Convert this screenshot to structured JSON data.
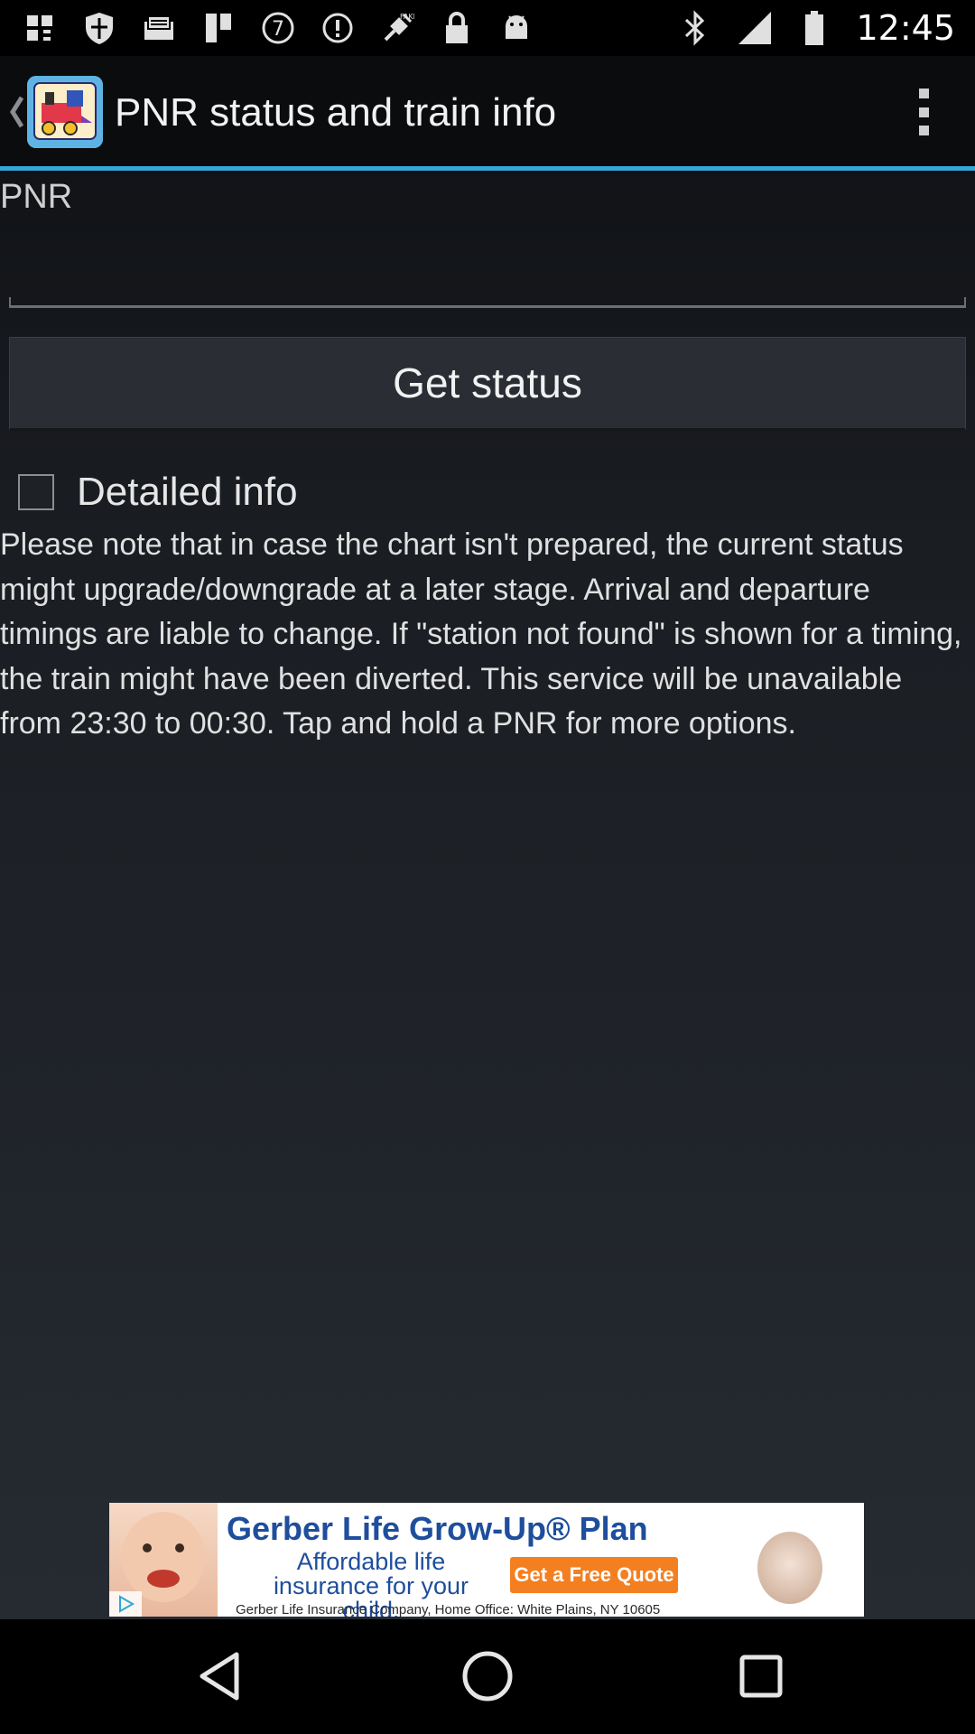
{
  "status_bar": {
    "left_icons": [
      "notification-icon",
      "shield-icon",
      "mail-icon",
      "flag-icon",
      "circled-seven-icon",
      "info-icon",
      "fake-gps-icon",
      "lock-icon",
      "android-icon"
    ],
    "right_icons": [
      "bluetooth-icon"
    ],
    "time": "12:45"
  },
  "action_bar": {
    "title": "PNR status and train info",
    "accent_color": "#33a7d8",
    "icons": [
      "back-chevron-icon",
      "app-train-icon",
      "overflow-menu-icon"
    ]
  },
  "form": {
    "pnr_label": "PNR",
    "pnr_value": "",
    "get_status_label": "Get status",
    "detailed_info_label": "Detailed info",
    "detailed_info_checked": false
  },
  "note": "Please note that in case the chart isn't prepared, the current status might upgrade/downgrade at a later stage. Arrival and departure timings are liable to change. If \"station not found\" is shown for a timing, the train might have been diverted. This service will be unavailable from 23:30 to 00:30. Tap and hold a PNR for more options.",
  "ad": {
    "title": "Gerber Life Grow-Up® Plan",
    "subtitle": "Affordable life insurance for your child.",
    "cta": "Get a Free Quote",
    "footer": "Gerber Life Insurance Company, Home Office: White Plains, NY 10605",
    "brand_color": "#1e4e9c",
    "cta_color": "#f47f20"
  },
  "nav_bar": {
    "icons": [
      "back-triangle-icon",
      "home-circle-icon",
      "recents-square-icon"
    ]
  }
}
